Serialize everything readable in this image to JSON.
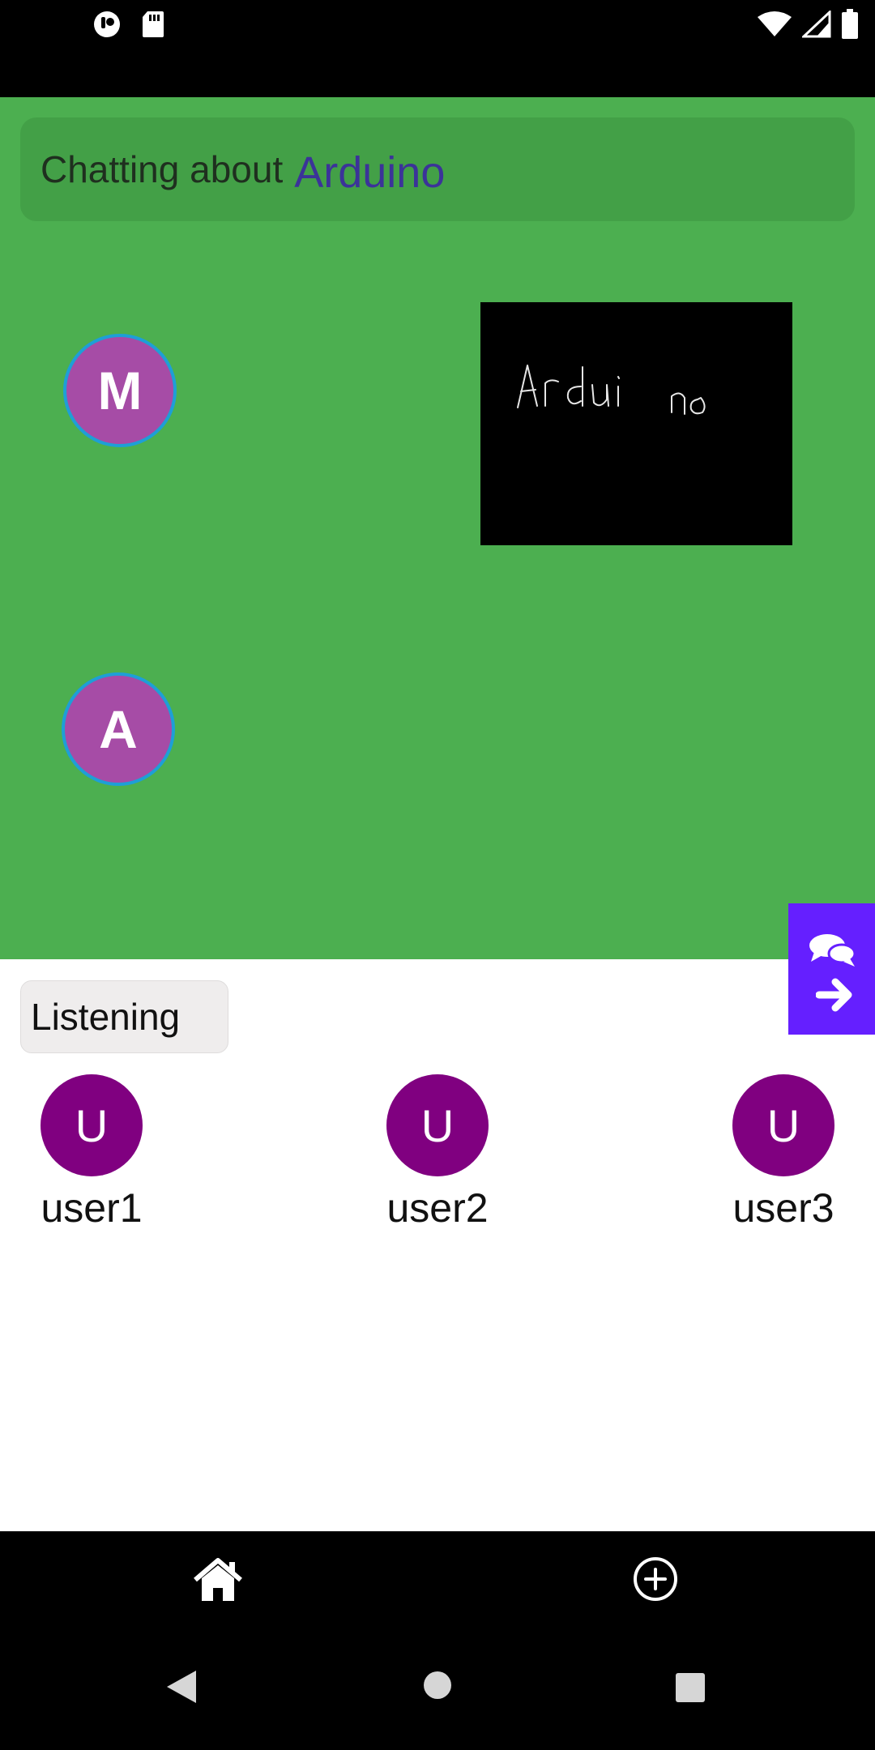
{
  "status_bar": {
    "icons": [
      "notification-app-icon",
      "sd-card-icon",
      "wifi-icon",
      "cell-signal-icon",
      "battery-icon"
    ]
  },
  "topic": {
    "prefix": "Chatting about",
    "name": "Arduino"
  },
  "speakers": [
    {
      "initial": "M"
    },
    {
      "initial": "A"
    }
  ],
  "drawing": {
    "text": "Arduino"
  },
  "chat_fab": {
    "icons": [
      "chat-bubbles-icon",
      "arrow-right-icon"
    ]
  },
  "listening": {
    "label": "Listening"
  },
  "listeners": [
    {
      "initial": "U",
      "name": "user1"
    },
    {
      "initial": "U",
      "name": "user2"
    },
    {
      "initial": "U",
      "name": "user3"
    }
  ],
  "bottom_nav": {
    "icons": [
      "home-icon",
      "add-circle-icon"
    ]
  },
  "system_nav": {
    "icons": [
      "back-icon",
      "home-circle-icon",
      "recents-icon"
    ]
  },
  "colors": {
    "stage": "#4caf50",
    "topic_bar": "#43a047",
    "topic_name": "#3b3399",
    "speaker": "#a64ca6",
    "speaker_ring": "#1e9fd6",
    "listener_avatar": "#800080",
    "chat_fab": "#651fff"
  }
}
